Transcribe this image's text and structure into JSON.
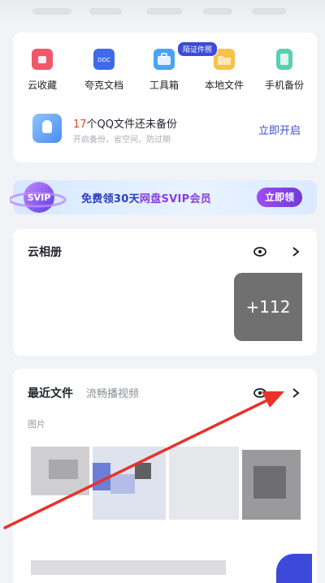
{
  "tools": {
    "items": [
      {
        "label": "云收藏",
        "icon": "cloud-favorites-icon",
        "color": "#f0586a"
      },
      {
        "label": "夸克文档",
        "icon": "quark-doc-icon",
        "color": "#3f6be8"
      },
      {
        "label": "工具箱",
        "icon": "toolbox-icon",
        "color": "#4aa3f5"
      },
      {
        "label": "本地文件",
        "icon": "local-folder-icon",
        "color": "#f6c34a"
      },
      {
        "label": "手机备份",
        "icon": "phone-backup-icon",
        "color": "#5ccfb0"
      }
    ],
    "badge": "陌证件照"
  },
  "backup": {
    "count": "17",
    "title_rest": "个QQ文件还未备份",
    "subtitle": "开启备份，省空间，防过期",
    "action": "立即开启"
  },
  "banner": {
    "logo": "SVIP",
    "text_a": "免费领30天",
    "text_b": "网盘SVIP会员",
    "button": "立即领"
  },
  "album": {
    "title": "云相册",
    "more_count": "+112"
  },
  "recent": {
    "title": "最近文件",
    "subtitle": "流畅播视频",
    "category": "图片"
  }
}
